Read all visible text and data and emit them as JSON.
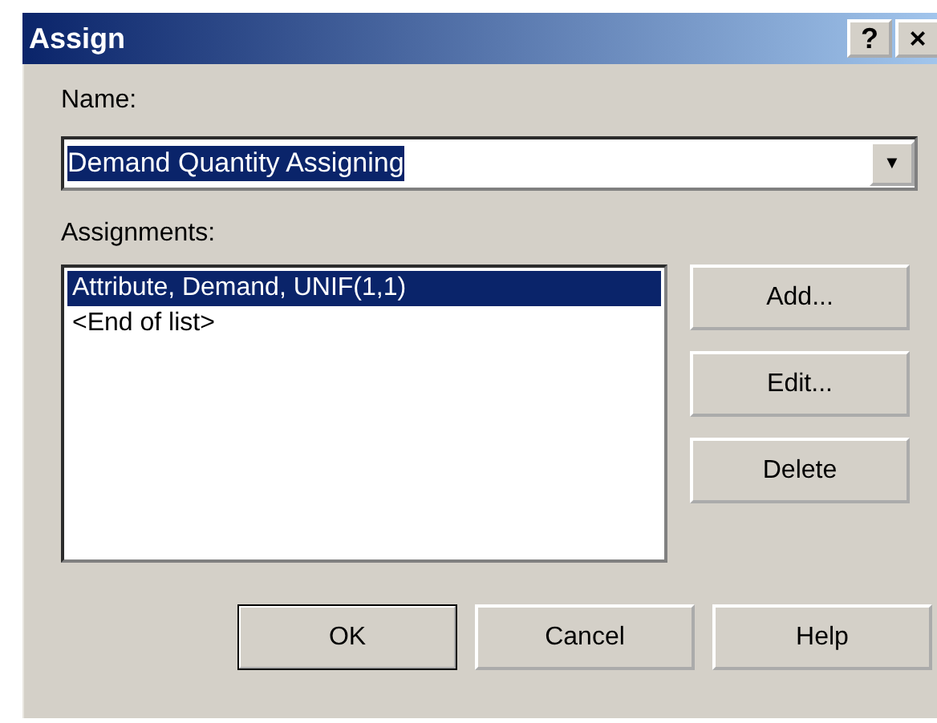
{
  "window": {
    "title": "Assign",
    "help_button": "?",
    "close_button": "×"
  },
  "name_field": {
    "label": "Name:",
    "value": "Demand Quantity Assigning",
    "selected": true,
    "dropdown_arrow": "▼"
  },
  "assignments": {
    "label": "Assignments:",
    "items": [
      {
        "text": "Attribute, Demand, UNIF(1,1)",
        "selected": true
      },
      {
        "text": "<End of list>",
        "selected": false
      }
    ]
  },
  "side_buttons": [
    {
      "label": "Add...",
      "default": false
    },
    {
      "label": "Edit...",
      "default": false
    },
    {
      "label": "Delete",
      "default": false
    }
  ],
  "bottom_buttons": [
    {
      "label": "OK",
      "default": true
    },
    {
      "label": "Cancel",
      "default": false
    },
    {
      "label": "Help",
      "default": false
    }
  ]
}
